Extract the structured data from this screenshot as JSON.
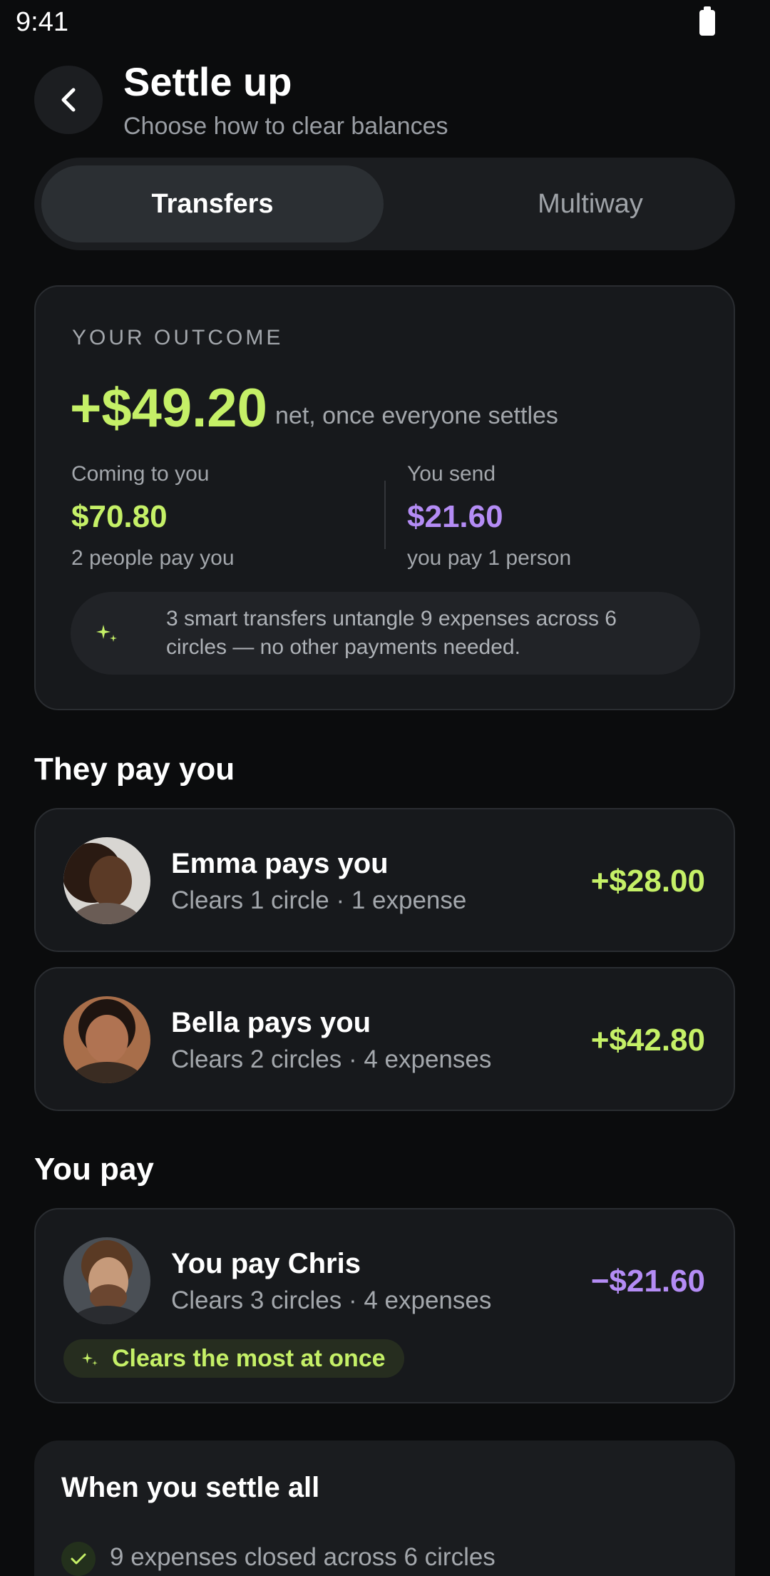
{
  "status_bar": {
    "time": "9:41"
  },
  "header": {
    "title": "Settle up",
    "subtitle": "Choose how to clear balances"
  },
  "tabs": [
    {
      "label": "Transfers",
      "selected": true
    },
    {
      "label": "Multiway",
      "selected": false
    }
  ],
  "outcome": {
    "label": "YOUR OUTCOME",
    "amount": "+$49.20",
    "note": "net, once everyone settles",
    "incoming": {
      "label": "Coming to you",
      "amount": "$70.80",
      "note": "2 people pay you"
    },
    "outgoing": {
      "label": "You send",
      "amount": "$21.60",
      "note": "you pay 1 person"
    },
    "hint": "3 smart transfers untangle 9 expenses across 6 circles — no other payments needed."
  },
  "sections": {
    "they_pay": "They pay you",
    "you_pay": "You pay"
  },
  "incoming_transfers": [
    {
      "name": "Emma pays you",
      "meta": "Clears 1 circle · 1 expense",
      "amount": "+$28.00"
    },
    {
      "name": "Bella pays you",
      "meta": "Clears 2 circles · 4 expenses",
      "amount": "+$42.80"
    }
  ],
  "outgoing_transfers": [
    {
      "name": "You pay Chris",
      "meta": "Clears 3 circles · 4 expenses",
      "amount": "−$21.60",
      "tag": "Clears the most at once"
    }
  ],
  "summary": {
    "title": "When you settle all",
    "items": [
      "9 expenses closed across 6 circles"
    ]
  },
  "colors": {
    "positive": "#c5f067",
    "negative": "#b48cf5",
    "background": "#0b0c0d",
    "card": "#17191c"
  },
  "icons": [
    "back-arrow-icon",
    "sparkle-icon",
    "check-icon",
    "battery-icon"
  ]
}
